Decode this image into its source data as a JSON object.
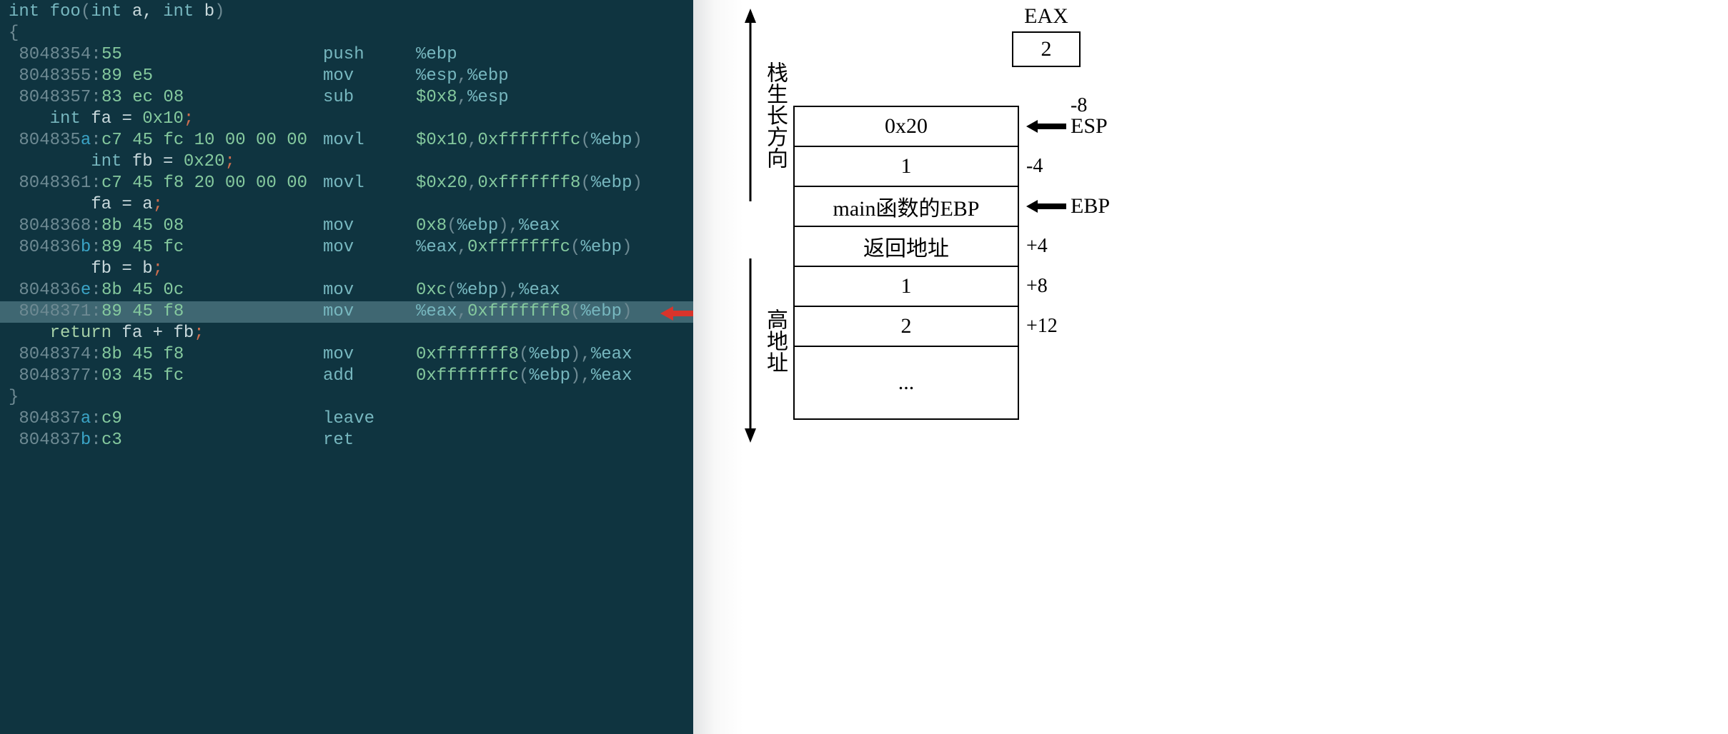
{
  "ip_label": "IP",
  "signature": {
    "ret": "int",
    "name": "foo",
    "params": "int a, int b"
  },
  "lines": [
    {
      "k": "sig"
    },
    {
      "k": "brace_open"
    },
    {
      "k": "asm",
      "addr": "8048354",
      "ab": "",
      "hex": "55",
      "mn": "push",
      "args": [
        {
          "t": "reg",
          "v": "%ebp"
        }
      ]
    },
    {
      "k": "asm",
      "addr": "8048355",
      "ab": "",
      "hex": "89 e5",
      "mn": "mov",
      "args": [
        {
          "t": "reg",
          "v": "%esp"
        },
        {
          "t": "punc",
          "v": ","
        },
        {
          "t": "reg",
          "v": "%ebp"
        }
      ]
    },
    {
      "k": "asm",
      "addr": "8048357",
      "ab": "",
      "hex": "83 ec 08",
      "mn": "sub",
      "args": [
        {
          "t": "num",
          "v": "$0x8"
        },
        {
          "t": "punc",
          "v": ","
        },
        {
          "t": "reg",
          "v": "%esp"
        }
      ]
    },
    {
      "k": "src",
      "indent": 4,
      "text": [
        {
          "t": "type",
          "v": "int"
        },
        {
          "t": "plain",
          "v": " fa = "
        },
        {
          "t": "num",
          "v": "0x10"
        },
        {
          "t": "semi",
          "v": ";"
        }
      ]
    },
    {
      "k": "asm",
      "addr": "804835",
      "ab": "a",
      "hex": "c7 45 fc 10 00 00 00",
      "mn": "movl",
      "args": [
        {
          "t": "num",
          "v": "$0x10"
        },
        {
          "t": "punc",
          "v": ","
        },
        {
          "t": "num",
          "v": "0xfffffffc"
        },
        {
          "t": "punc",
          "v": "("
        },
        {
          "t": "reg",
          "v": "%ebp"
        },
        {
          "t": "punc",
          "v": ")"
        }
      ]
    },
    {
      "k": "src",
      "indent": 8,
      "text": [
        {
          "t": "type",
          "v": "int"
        },
        {
          "t": "plain",
          "v": " fb = "
        },
        {
          "t": "num",
          "v": "0x20"
        },
        {
          "t": "semi",
          "v": ";"
        }
      ]
    },
    {
      "k": "asm",
      "addr": "8048361",
      "ab": "",
      "hex": "c7 45 f8 20 00 00 00",
      "mn": "movl",
      "args": [
        {
          "t": "num",
          "v": "$0x20"
        },
        {
          "t": "punc",
          "v": ","
        },
        {
          "t": "num",
          "v": "0xfffffff8"
        },
        {
          "t": "punc",
          "v": "("
        },
        {
          "t": "reg",
          "v": "%ebp"
        },
        {
          "t": "punc",
          "v": ")"
        }
      ]
    },
    {
      "k": "src",
      "indent": 8,
      "text": [
        {
          "t": "plain",
          "v": "fa = a"
        },
        {
          "t": "semi",
          "v": ";"
        }
      ]
    },
    {
      "k": "asm",
      "addr": "8048368",
      "ab": "",
      "hex": "8b 45 08",
      "mn": "mov",
      "args": [
        {
          "t": "num",
          "v": "0x8"
        },
        {
          "t": "punc",
          "v": "("
        },
        {
          "t": "reg",
          "v": "%ebp"
        },
        {
          "t": "punc",
          "v": ")"
        },
        {
          "t": "punc",
          "v": ","
        },
        {
          "t": "reg",
          "v": "%eax"
        }
      ]
    },
    {
      "k": "asm",
      "addr": "804836",
      "ab": "b",
      "hex": "89 45 fc",
      "mn": "mov",
      "args": [
        {
          "t": "reg",
          "v": "%eax"
        },
        {
          "t": "punc",
          "v": ","
        },
        {
          "t": "num",
          "v": "0xfffffffc"
        },
        {
          "t": "punc",
          "v": "("
        },
        {
          "t": "reg",
          "v": "%ebp"
        },
        {
          "t": "punc",
          "v": ")"
        }
      ]
    },
    {
      "k": "src",
      "indent": 8,
      "text": [
        {
          "t": "plain",
          "v": "fb = b"
        },
        {
          "t": "semi",
          "v": ";"
        }
      ]
    },
    {
      "k": "asm",
      "addr": "804836",
      "ab": "e",
      "hex": "8b 45 0c",
      "mn": "mov",
      "args": [
        {
          "t": "num",
          "v": "0xc"
        },
        {
          "t": "punc",
          "v": "("
        },
        {
          "t": "reg",
          "v": "%ebp"
        },
        {
          "t": "punc",
          "v": ")"
        },
        {
          "t": "punc",
          "v": ","
        },
        {
          "t": "reg",
          "v": "%eax"
        }
      ]
    },
    {
      "k": "asm",
      "hl": true,
      "addr": "8048371",
      "ab": "",
      "hex": "89 45 f8",
      "mn": "mov",
      "args": [
        {
          "t": "reg",
          "v": "%eax"
        },
        {
          "t": "punc",
          "v": ","
        },
        {
          "t": "num",
          "v": "0xfffffff8"
        },
        {
          "t": "punc",
          "v": "("
        },
        {
          "t": "reg",
          "v": "%ebp"
        },
        {
          "t": "punc",
          "v": ")"
        }
      ]
    },
    {
      "k": "src",
      "indent": 4,
      "text": [
        {
          "t": "key",
          "v": "return"
        },
        {
          "t": "plain",
          "v": " fa + fb"
        },
        {
          "t": "semi",
          "v": ";"
        }
      ]
    },
    {
      "k": "asm",
      "addr": "8048374",
      "ab": "",
      "hex": "8b 45 f8",
      "mn": "mov",
      "args": [
        {
          "t": "num",
          "v": "0xfffffff8"
        },
        {
          "t": "punc",
          "v": "("
        },
        {
          "t": "reg",
          "v": "%ebp"
        },
        {
          "t": "punc",
          "v": ")"
        },
        {
          "t": "punc",
          "v": ","
        },
        {
          "t": "reg",
          "v": "%eax"
        }
      ]
    },
    {
      "k": "asm",
      "addr": "8048377",
      "ab": "",
      "hex": "03 45 fc",
      "mn": "add",
      "args": [
        {
          "t": "num",
          "v": "0xfffffffc"
        },
        {
          "t": "punc",
          "v": "("
        },
        {
          "t": "reg",
          "v": "%ebp"
        },
        {
          "t": "punc",
          "v": ")"
        },
        {
          "t": "punc",
          "v": ","
        },
        {
          "t": "reg",
          "v": "%eax"
        }
      ]
    },
    {
      "k": "brace_close"
    },
    {
      "k": "asm",
      "addr": "804837",
      "ab": "a",
      "hex": "c9",
      "mn": "leave",
      "args": []
    },
    {
      "k": "asm",
      "addr": "804837",
      "ab": "b",
      "hex": "c3",
      "mn": "ret",
      "args": []
    }
  ],
  "diagram": {
    "growth_label": "栈生长方向",
    "high_label": "高地址",
    "eax": {
      "title": "EAX",
      "value": "2"
    },
    "stack": [
      {
        "val": "0x20",
        "off": "-8",
        "ptr": "ESP"
      },
      {
        "val": "1",
        "off": "-4"
      },
      {
        "val": "main函数的EBP",
        "ptr": "EBP"
      },
      {
        "val": "返回地址",
        "off": "+4"
      },
      {
        "val": "1",
        "off": "+8"
      },
      {
        "val": "2",
        "off": "+12"
      },
      {
        "val": "..."
      }
    ]
  }
}
